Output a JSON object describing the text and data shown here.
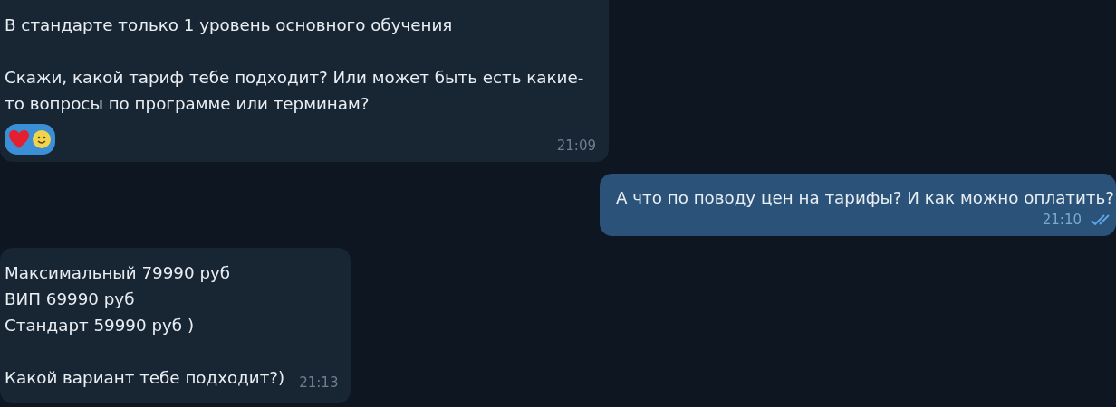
{
  "messages": [
    {
      "kind": "incoming",
      "paragraphs": [
        "В стандарте только 1 уровень основного обучения",
        "Скажи, какой тариф тебе подходит? Или может быть есть какие-то вопросы по программе или терминам?"
      ],
      "reactions": [
        {
          "kind": "heart"
        },
        {
          "kind": "smiley"
        }
      ],
      "time": "21:09"
    },
    {
      "kind": "outgoing",
      "paragraphs": [
        "А что по поводу цен на тарифы? И как можно оплатить?"
      ],
      "time": "21:10",
      "read": true
    },
    {
      "kind": "incoming",
      "paragraphs": [
        "Максимальный 79990 руб\nВИП 69990 руб\nСтандарт 59990 руб )",
        "Какой вариант тебе подходит?)"
      ],
      "time": "21:13"
    }
  ]
}
